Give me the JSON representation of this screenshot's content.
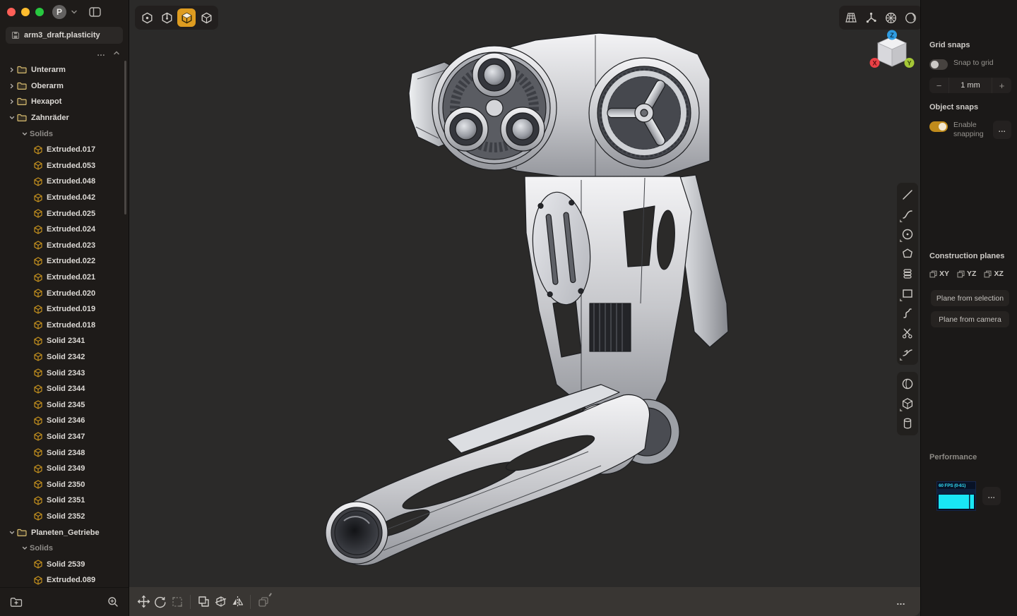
{
  "window": {
    "controls": [
      "close-button",
      "minimize-button",
      "zoom-button"
    ],
    "app_logo": "P",
    "titlebar_icons": [
      "chevron-down-icon",
      "sidebar-toggle-icon"
    ]
  },
  "sidebar": {
    "file": {
      "icon": "save-icon",
      "name": "arm3_draft.plasticity"
    },
    "tree_tools": {
      "more": "…",
      "collapse_icon": "chevron-up-icon"
    },
    "tree": [
      {
        "depth": 0,
        "kind": "folder",
        "chevron": "right",
        "label": "Unterarm"
      },
      {
        "depth": 0,
        "kind": "folder",
        "chevron": "right",
        "label": "Oberarm"
      },
      {
        "depth": 0,
        "kind": "folder",
        "chevron": "right",
        "label": "Hexapot"
      },
      {
        "depth": 0,
        "kind": "folder",
        "chevron": "down",
        "label": "Zahnräder"
      },
      {
        "depth": 1,
        "kind": "group",
        "chevron": "down",
        "label": "Solids"
      },
      {
        "depth": 2,
        "kind": "solid",
        "chevron": "none",
        "label": "Extruded.017"
      },
      {
        "depth": 2,
        "kind": "solid",
        "chevron": "none",
        "label": "Extruded.053"
      },
      {
        "depth": 2,
        "kind": "solid",
        "chevron": "none",
        "label": "Extruded.048"
      },
      {
        "depth": 2,
        "kind": "solid",
        "chevron": "none",
        "label": "Extruded.042"
      },
      {
        "depth": 2,
        "kind": "solid",
        "chevron": "none",
        "label": "Extruded.025"
      },
      {
        "depth": 2,
        "kind": "solid",
        "chevron": "none",
        "label": "Extruded.024"
      },
      {
        "depth": 2,
        "kind": "solid",
        "chevron": "none",
        "label": "Extruded.023"
      },
      {
        "depth": 2,
        "kind": "solid",
        "chevron": "none",
        "label": "Extruded.022"
      },
      {
        "depth": 2,
        "kind": "solid",
        "chevron": "none",
        "label": "Extruded.021"
      },
      {
        "depth": 2,
        "kind": "solid",
        "chevron": "none",
        "label": "Extruded.020"
      },
      {
        "depth": 2,
        "kind": "solid",
        "chevron": "none",
        "label": "Extruded.019"
      },
      {
        "depth": 2,
        "kind": "solid",
        "chevron": "none",
        "label": "Extruded.018"
      },
      {
        "depth": 2,
        "kind": "solid",
        "chevron": "none",
        "label": "Solid 2341"
      },
      {
        "depth": 2,
        "kind": "solid",
        "chevron": "none",
        "label": "Solid 2342"
      },
      {
        "depth": 2,
        "kind": "solid",
        "chevron": "none",
        "label": "Solid 2343"
      },
      {
        "depth": 2,
        "kind": "solid",
        "chevron": "none",
        "label": "Solid 2344"
      },
      {
        "depth": 2,
        "kind": "solid",
        "chevron": "none",
        "label": "Solid 2345"
      },
      {
        "depth": 2,
        "kind": "solid",
        "chevron": "none",
        "label": "Solid 2346"
      },
      {
        "depth": 2,
        "kind": "solid",
        "chevron": "none",
        "label": "Solid 2347"
      },
      {
        "depth": 2,
        "kind": "solid",
        "chevron": "none",
        "label": "Solid 2348"
      },
      {
        "depth": 2,
        "kind": "solid",
        "chevron": "none",
        "label": "Solid 2349"
      },
      {
        "depth": 2,
        "kind": "solid",
        "chevron": "none",
        "label": "Solid 2350"
      },
      {
        "depth": 2,
        "kind": "solid",
        "chevron": "none",
        "label": "Solid 2351"
      },
      {
        "depth": 2,
        "kind": "solid",
        "chevron": "none",
        "label": "Solid 2352"
      },
      {
        "depth": 0,
        "kind": "folder",
        "chevron": "down",
        "label": "Planeten_Getriebe"
      },
      {
        "depth": 1,
        "kind": "group",
        "chevron": "down",
        "label": "Solids"
      },
      {
        "depth": 2,
        "kind": "solid",
        "chevron": "none",
        "label": "Solid 2539"
      },
      {
        "depth": 2,
        "kind": "solid",
        "chevron": "none",
        "label": "Extruded.089"
      }
    ],
    "footer_icons": [
      "new-folder-icon",
      "search-icon"
    ]
  },
  "viewport": {
    "selection_modes": [
      {
        "icon": "vertex-select-icon",
        "active": false
      },
      {
        "icon": "edge-select-icon",
        "active": false
      },
      {
        "icon": "face-select-icon",
        "active": true
      },
      {
        "icon": "body-select-icon",
        "active": false
      }
    ],
    "display_toolbar_icons": [
      "grid-icon",
      "tripod-icon",
      "spoked-wheel-icon",
      "matcap-sphere-icon"
    ],
    "view_cube": {
      "axes": [
        {
          "label": "X",
          "color": "#ea4146"
        },
        {
          "label": "Y",
          "color": "#a5c837"
        },
        {
          "label": "Z",
          "color": "#2f9be0"
        }
      ]
    },
    "draw_tools_group1": [
      "line-icon",
      "curve-icon",
      "circle-center-icon",
      "polygon-icon",
      "stacked-ellipses-icon",
      "rectangle-icon",
      "spline-icon",
      "scissors-icon",
      "offset-curve-icon"
    ],
    "draw_tools_group2": [
      "sphere-icon",
      "cube-icon",
      "cylinder-icon"
    ],
    "bottom_toolbar": [
      "move-icon",
      "rotate-icon",
      "scale-icon",
      "boolean-icon",
      "cut-icon",
      "mirror-icon",
      "duplicate-icon"
    ],
    "bottom_more": "…"
  },
  "right_panel": {
    "grid_snaps": {
      "title": "Grid snaps",
      "toggle_label": "Snap to grid",
      "toggle_on": false,
      "decrement": "−",
      "value": "1 mm",
      "increment": "+"
    },
    "object_snaps": {
      "title": "Object snaps",
      "toggle_label": "Enable snapping",
      "toggle_on": true,
      "more": "…"
    },
    "construction_planes": {
      "title": "Construction planes",
      "planes": [
        "XY",
        "YZ",
        "XZ"
      ],
      "buttons": [
        "Plane from selection",
        "Plane from camera"
      ]
    },
    "performance": {
      "title": "Performance",
      "fps_label": "60 FPS (0-61)",
      "more": "…"
    }
  }
}
